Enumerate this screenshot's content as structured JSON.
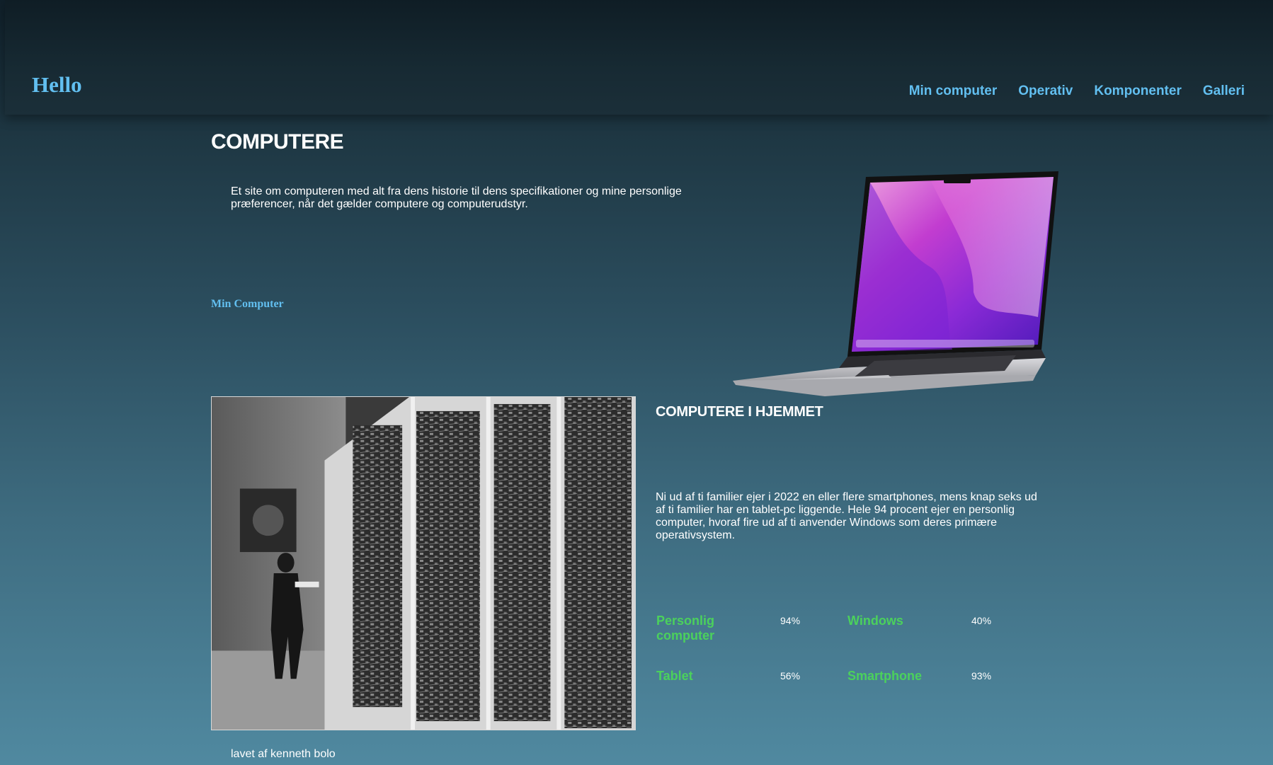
{
  "header": {
    "logo": "Hello",
    "nav": [
      {
        "label": "Min computer"
      },
      {
        "label": "Operativ"
      },
      {
        "label": "Komponenter"
      },
      {
        "label": "Galleri"
      }
    ]
  },
  "hero": {
    "title": "COMPUTERE",
    "intro": "Et site om computeren med alt fra dens historie til dens specifikationer og mine personlige præferencer, når det gælder computere og computerudstyr.",
    "link": "Min Computer",
    "image": "laptop-image"
  },
  "home_section": {
    "image": "historic-computer-photo",
    "title": "COMPUTERE I HJEMMET",
    "text": "Ni ud af ti familier ejer i 2022 en eller flere smartphones, mens knap seks ud af ti familier har en tablet-pc liggende. Hele 94 procent ejer en personlig computer, hvoraf fire ud af ti anvender Windows som deres primære operativsystem.",
    "stats": [
      {
        "label": "Personlig computer",
        "value": "94%"
      },
      {
        "label": "Windows",
        "value": "40%"
      },
      {
        "label": "Tablet",
        "value": "56%"
      },
      {
        "label": "Smartphone",
        "value": "93%"
      }
    ]
  },
  "footer": {
    "credit": "lavet af kenneth bolo"
  },
  "colors": {
    "accent": "#62bff0",
    "stat_label": "#4bd15c",
    "text": "#ffffff"
  }
}
